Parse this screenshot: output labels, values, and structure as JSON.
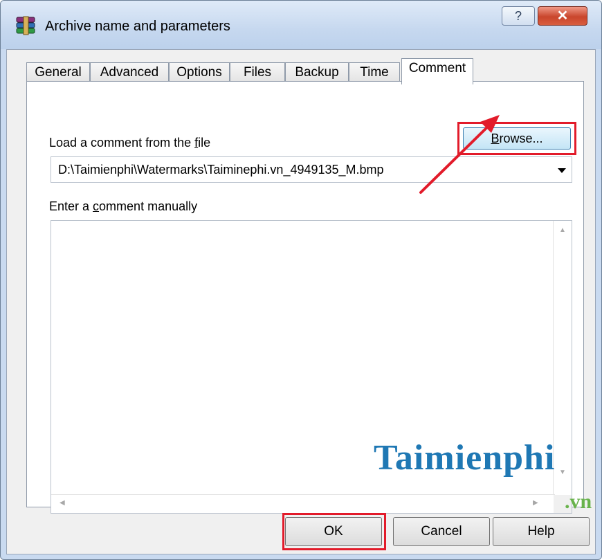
{
  "window": {
    "title": "Archive name and parameters",
    "help_glyph": "?",
    "close_glyph": "✕"
  },
  "tabs": [
    {
      "label": "General"
    },
    {
      "label": "Advanced"
    },
    {
      "label": "Options"
    },
    {
      "label": "Files"
    },
    {
      "label": "Backup"
    },
    {
      "label": "Time"
    },
    {
      "label": "Comment",
      "active": true
    }
  ],
  "comment": {
    "load_label_pre": "Load a comment from the ",
    "load_label_accel": "f",
    "load_label_post": "ile",
    "browse_accel": "B",
    "browse_rest": "rowse...",
    "file_path": "D:\\Taimienphi\\Watermarks\\Taiminephi.vn_4949135_M.bmp",
    "enter_label_pre": "Enter a ",
    "enter_label_accel": "c",
    "enter_label_post": "omment manually",
    "comment_text": ""
  },
  "buttons": {
    "ok": "OK",
    "cancel": "Cancel",
    "help": "Help"
  },
  "watermark": {
    "main": "Taimienphi",
    "sub": ".vn"
  },
  "icons": [
    "winrar-archive-icon",
    "help-icon",
    "close-icon",
    "dropdown-arrow-icon",
    "scroll-up-icon",
    "scroll-down-icon",
    "scroll-left-icon",
    "scroll-right-icon"
  ],
  "colors": {
    "highlight": "#e21b2a",
    "focused_button": "#c4e5f6",
    "watermark_blue": "#1f78b4",
    "watermark_green": "#69b34c"
  }
}
